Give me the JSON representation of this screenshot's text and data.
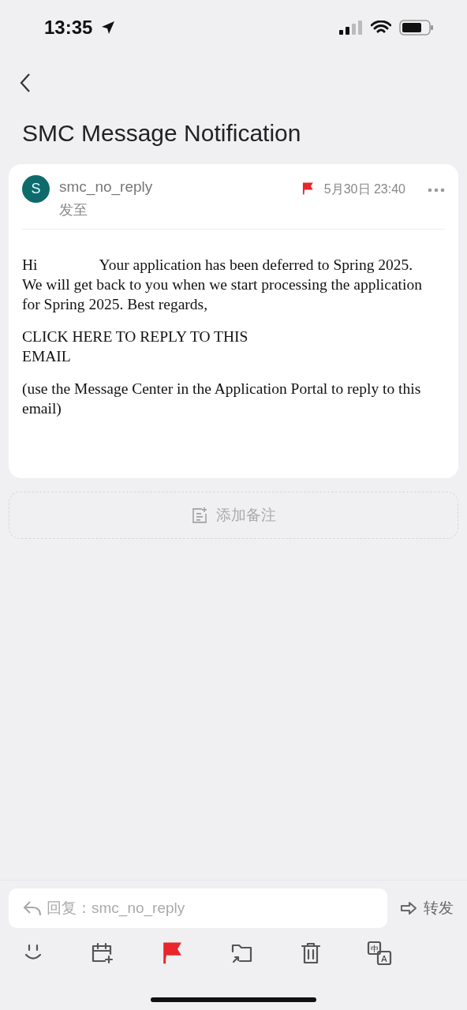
{
  "status_bar": {
    "time": "13:35"
  },
  "title": "SMC Message Notification",
  "message": {
    "avatar": "S",
    "sender": "smc_no_reply",
    "to_label": "发至",
    "flagged": true,
    "date": "5月30日 23:40",
    "greeting": "Hi",
    "paragraphs": [
      "Your application has been deferred to Spring 2025. We will get back to you when we start processing the application for Spring 2025. Best regards,",
      "CLICK HERE TO REPLY TO THIS\nEMAIL",
      "(use the Message Center in the Application Portal to reply to this email)"
    ]
  },
  "add_note": "添加备注",
  "reply": {
    "placeholder": "回复：smc_no_reply"
  },
  "forward": "转发",
  "toolbar": [
    {
      "kind": "emoji"
    },
    {
      "kind": "calendar"
    },
    {
      "kind": "flag",
      "on": true
    },
    {
      "kind": "move"
    },
    {
      "kind": "delete"
    },
    {
      "kind": "translate",
      "labels": [
        "中",
        "A"
      ]
    }
  ]
}
